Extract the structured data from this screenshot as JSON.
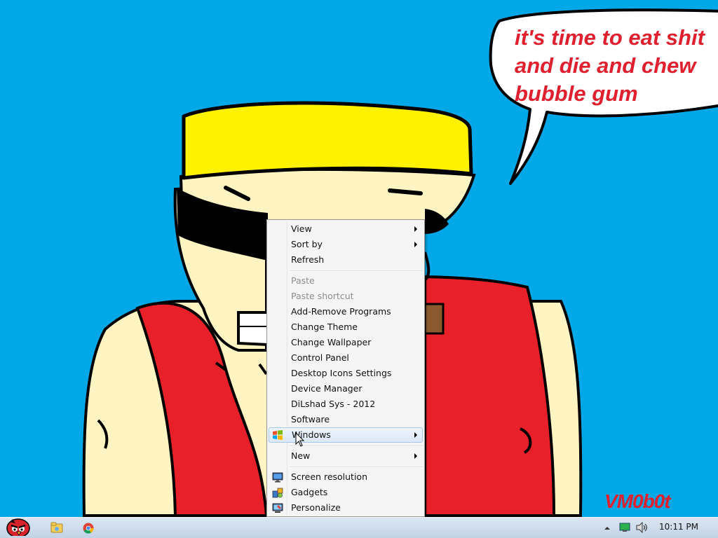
{
  "wallpaper": {
    "speech_lines": [
      "it's time to eat shit",
      "and die and chew",
      "bubble gum"
    ],
    "signature": "VM0b0t",
    "colors": {
      "sky": "#00a8e8",
      "hat": "#fff200",
      "skin": "#fff4c2",
      "shirt": "#e8202a",
      "text_red": "#e0202e"
    }
  },
  "context_menu": {
    "items": [
      {
        "label": "View",
        "submenu": true
      },
      {
        "label": "Sort by",
        "submenu": true
      },
      {
        "label": "Refresh"
      },
      {
        "label": "Paste",
        "disabled": true
      },
      {
        "label": "Paste shortcut",
        "disabled": true
      },
      {
        "label": "Add-Remove Programs"
      },
      {
        "label": "Change Theme"
      },
      {
        "label": "Change Wallpaper"
      },
      {
        "label": "Control Panel"
      },
      {
        "label": "Desktop Icons Settings"
      },
      {
        "label": "Device Manager"
      },
      {
        "label": "DiLshad Sys - 2012"
      },
      {
        "label": "Software"
      },
      {
        "label": "Windows",
        "submenu": true,
        "highlighted": true,
        "icon": "windows-logo-icon"
      },
      {
        "label": "New",
        "submenu": true
      },
      {
        "label": "Screen resolution",
        "icon": "monitor-icon"
      },
      {
        "label": "Gadgets",
        "icon": "gadgets-icon"
      },
      {
        "label": "Personalize",
        "icon": "personalize-icon"
      }
    ]
  },
  "taskbar": {
    "pinned": [
      {
        "name": "angry-birds-start-button-icon"
      },
      {
        "name": "windows-explorer-icon"
      },
      {
        "name": "chrome-icon"
      }
    ],
    "tray_icons": [
      "show-hidden-icons-arrow",
      "network-icon",
      "volume-icon"
    ],
    "clock": "10:11 PM"
  }
}
